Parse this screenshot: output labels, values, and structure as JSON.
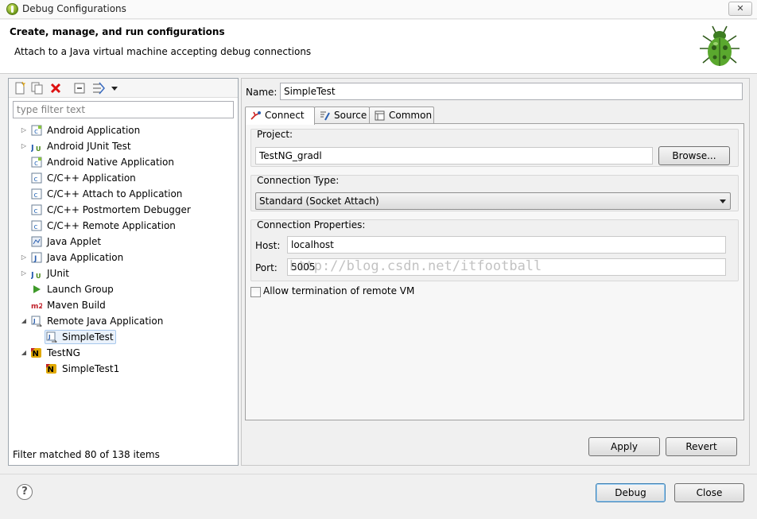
{
  "window": {
    "title": "Debug Configurations",
    "close_glyph": "✕"
  },
  "header": {
    "title": "Create, manage, and run configurations",
    "subtitle": "Attach to a Java virtual machine accepting debug connections"
  },
  "left": {
    "filter_placeholder": "type filter text",
    "tree": [
      {
        "label": "Android Application",
        "icon": "android-app-icon",
        "twisty": "collapsed",
        "level": 0
      },
      {
        "label": "Android JUnit Test",
        "icon": "junit-icon",
        "twisty": "collapsed",
        "level": 0
      },
      {
        "label": "Android Native Application",
        "icon": "android-app-icon",
        "twisty": "none",
        "level": 0
      },
      {
        "label": "C/C++ Application",
        "icon": "c-app-icon",
        "twisty": "none",
        "level": 0
      },
      {
        "label": "C/C++ Attach to Application",
        "icon": "c-app-icon",
        "twisty": "none",
        "level": 0
      },
      {
        "label": "C/C++ Postmortem Debugger",
        "icon": "c-app-icon",
        "twisty": "none",
        "level": 0
      },
      {
        "label": "C/C++ Remote Application",
        "icon": "c-app-icon",
        "twisty": "none",
        "level": 0
      },
      {
        "label": "Java Applet",
        "icon": "java-applet-icon",
        "twisty": "none",
        "level": 0
      },
      {
        "label": "Java Application",
        "icon": "java-app-icon",
        "twisty": "collapsed",
        "level": 0
      },
      {
        "label": "JUnit",
        "icon": "junit-icon",
        "twisty": "collapsed",
        "level": 0
      },
      {
        "label": "Launch Group",
        "icon": "launch-group-icon",
        "twisty": "none",
        "level": 0
      },
      {
        "label": "Maven Build",
        "icon": "maven-icon",
        "twisty": "none",
        "level": 0
      },
      {
        "label": "Remote Java Application",
        "icon": "remote-java-icon",
        "twisty": "expanded",
        "level": 0
      },
      {
        "label": "SimpleTest",
        "icon": "remote-java-icon",
        "twisty": "none",
        "level": 1,
        "selected": true
      },
      {
        "label": "TestNG",
        "icon": "testng-icon",
        "twisty": "expanded",
        "level": 0
      },
      {
        "label": "SimpleTest1",
        "icon": "testng-icon",
        "twisty": "none",
        "level": 1
      }
    ],
    "status": "Filter matched 80 of 138 items"
  },
  "right": {
    "name_label": "Name:",
    "name_value": "SimpleTest",
    "tabs": [
      {
        "label": "Connect",
        "icon": "connect-icon",
        "active": true
      },
      {
        "label": "Source",
        "icon": "source-icon",
        "active": false
      },
      {
        "label": "Common",
        "icon": "common-icon",
        "active": false
      }
    ],
    "project_label": "Project:",
    "project_value": "TestNG_gradl",
    "browse_label": "Browse...",
    "conn_type_label": "Connection Type:",
    "conn_type_value": "Standard (Socket Attach)",
    "conn_props_label": "Connection Properties:",
    "host_label": "Host:",
    "host_value": "localhost",
    "port_label": "Port:",
    "port_value": "5005",
    "allow_termination_label": "Allow termination of remote VM",
    "apply_label": "Apply",
    "revert_label": "Revert"
  },
  "watermark": "http://blog.csdn.net/itfootball",
  "footer": {
    "help_glyph": "?",
    "debug_label": "Debug",
    "close_label": "Close"
  }
}
